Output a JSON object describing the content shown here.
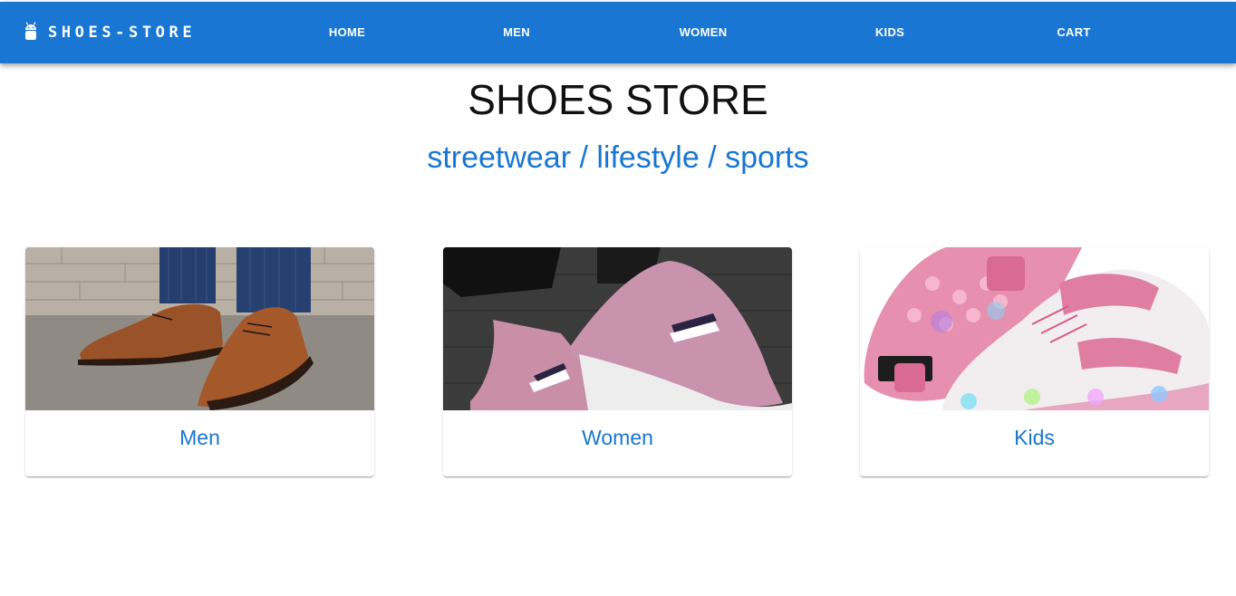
{
  "appbar": {
    "brand_icon": "android-icon",
    "brand_text": "SHOES-STORE",
    "nav": [
      {
        "label": "HOME"
      },
      {
        "label": "MEN"
      },
      {
        "label": "WOMEN"
      },
      {
        "label": "KIDS"
      },
      {
        "label": "CART"
      }
    ],
    "color": "#1976d2"
  },
  "hero": {
    "title": "SHOES STORE",
    "subtitle": "streetwear / lifestyle / sports"
  },
  "categories": [
    {
      "label": "Men",
      "image": "brown-oxford-shoes-photo"
    },
    {
      "label": "Women",
      "image": "pink-knit-sneakers-photo"
    },
    {
      "label": "Kids",
      "image": "pink-light-up-roller-sneakers-photo"
    }
  ],
  "colors": {
    "accent": "#1976d2",
    "title": "#111111",
    "background": "#ffffff"
  }
}
